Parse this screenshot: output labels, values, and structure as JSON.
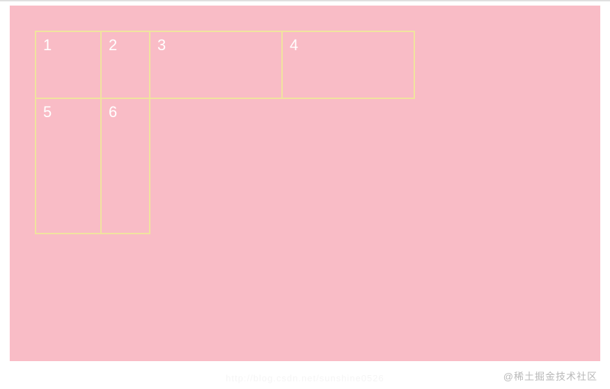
{
  "grid": {
    "cells": [
      {
        "label": "1"
      },
      {
        "label": "2"
      },
      {
        "label": "3"
      },
      {
        "label": "4"
      },
      {
        "label": "5"
      },
      {
        "label": "6"
      }
    ]
  },
  "watermark": "@稀土掘金技术社区",
  "url_watermark": "http://blog.csdn.net/sunshine0526"
}
